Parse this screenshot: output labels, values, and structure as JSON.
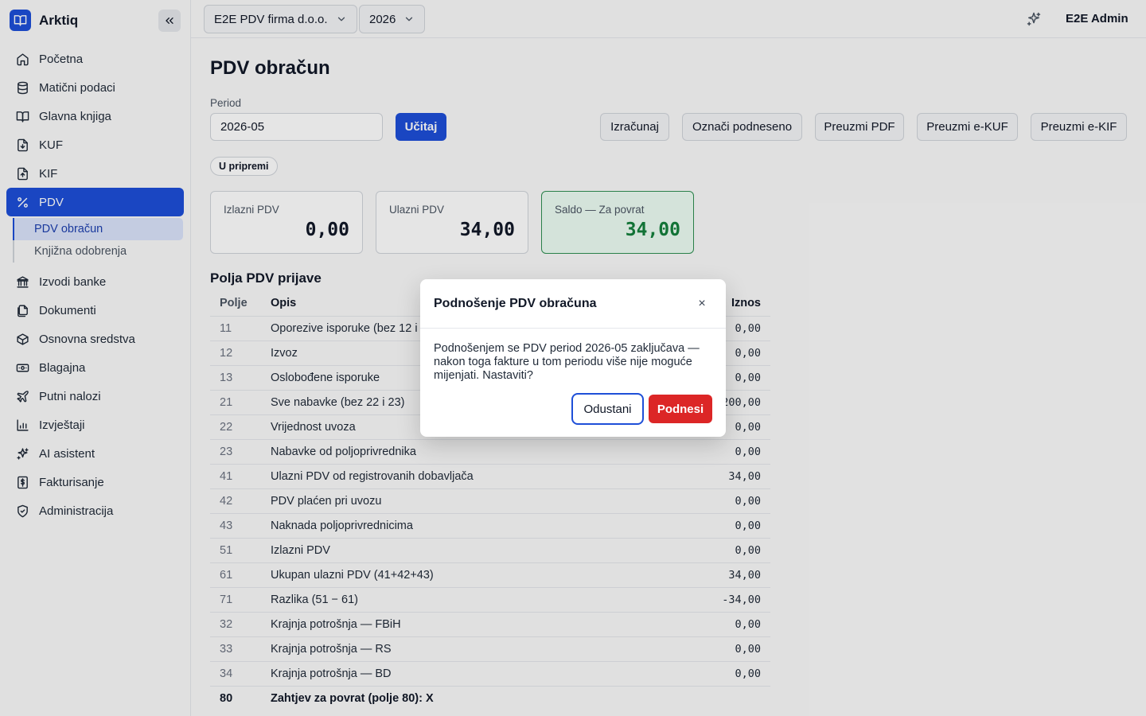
{
  "app": {
    "name": "Arktiq"
  },
  "sidebar": {
    "items": [
      {
        "label": "Početna",
        "icon": "home-icon"
      },
      {
        "label": "Matični podaci",
        "icon": "database-icon"
      },
      {
        "label": "Glavna knjiga",
        "icon": "book-open-icon"
      },
      {
        "label": "KUF",
        "icon": "file-download-icon"
      },
      {
        "label": "KIF",
        "icon": "file-upload-icon"
      },
      {
        "label": "PDV",
        "icon": "percent-icon",
        "active": true
      },
      {
        "label": "Izvodi banke",
        "icon": "bank-icon"
      },
      {
        "label": "Dokumenti",
        "icon": "documents-icon"
      },
      {
        "label": "Osnovna sredstva",
        "icon": "box-icon"
      },
      {
        "label": "Blagajna",
        "icon": "banknote-icon"
      },
      {
        "label": "Putni nalozi",
        "icon": "plane-icon"
      },
      {
        "label": "Izvještaji",
        "icon": "bar-chart-icon"
      },
      {
        "label": "AI asistent",
        "icon": "sparkles-icon"
      },
      {
        "label": "Fakturisanje",
        "icon": "invoice-dollar-icon"
      },
      {
        "label": "Administracija",
        "icon": "shield-icon"
      }
    ],
    "pdv_sub": [
      {
        "label": "PDV obračun",
        "active": true
      },
      {
        "label": "Knjižna odobrenja"
      }
    ]
  },
  "topbar": {
    "company": "E2E PDV firma d.o.o.",
    "year": "2026",
    "user": "E2E Admin"
  },
  "page": {
    "title": "PDV obračun",
    "period_label": "Period",
    "period_value": "2026-05",
    "load_button": "Učitaj",
    "actions": [
      "Izračunaj",
      "Označi podneseno",
      "Preuzmi PDF",
      "Preuzmi e-KUF",
      "Preuzmi e-KIF"
    ],
    "status": "U pripremi"
  },
  "cards": [
    {
      "label": "Izlazni PDV",
      "value": "0,00"
    },
    {
      "label": "Ulazni PDV",
      "value": "34,00"
    },
    {
      "label": "Saldo — Za povrat",
      "value": "34,00"
    }
  ],
  "fields": {
    "title": "Polja PDV prijave",
    "headers": {
      "polje": "Polje",
      "opis": "Opis",
      "iznos": "Iznos"
    },
    "rows": [
      {
        "polje": "11",
        "opis": "Oporezive isporuke (bez 12 i 13)",
        "iznos": "0,00"
      },
      {
        "polje": "12",
        "opis": "Izvoz",
        "iznos": "0,00"
      },
      {
        "polje": "13",
        "opis": "Oslobođene isporuke",
        "iznos": "0,00"
      },
      {
        "polje": "21",
        "opis": "Sve nabavke (bez 22 i 23)",
        "iznos": "200,00"
      },
      {
        "polje": "22",
        "opis": "Vrijednost uvoza",
        "iznos": "0,00"
      },
      {
        "polje": "23",
        "opis": "Nabavke od poljoprivrednika",
        "iznos": "0,00"
      },
      {
        "polje": "41",
        "opis": "Ulazni PDV od registrovanih dobavljača",
        "iznos": "34,00"
      },
      {
        "polje": "42",
        "opis": "PDV plaćen pri uvozu",
        "iznos": "0,00"
      },
      {
        "polje": "43",
        "opis": "Naknada poljoprivrednicima",
        "iznos": "0,00"
      },
      {
        "polje": "51",
        "opis": "Izlazni PDV",
        "iznos": "0,00"
      },
      {
        "polje": "61",
        "opis": "Ukupan ulazni PDV (41+42+43)",
        "iznos": "34,00"
      },
      {
        "polje": "71",
        "opis": "Razlika (51 − 61)",
        "iznos": "-34,00"
      },
      {
        "polje": "32",
        "opis": "Krajnja potrošnja — FBiH",
        "iznos": "0,00"
      },
      {
        "polje": "33",
        "opis": "Krajnja potrošnja — RS",
        "iznos": "0,00"
      },
      {
        "polje": "34",
        "opis": "Krajnja potrošnja — BD",
        "iznos": "0,00"
      },
      {
        "polje": "80",
        "opis": "Zahtjev za povrat (polje 80): X",
        "iznos": "",
        "bold": true
      }
    ]
  },
  "modal": {
    "title": "Podnošenje PDV obračuna",
    "close": "×",
    "body": "Podnošenjem se PDV period 2026-05 zaključava — nakon toga fakture u tom periodu više nije moguće mijenjati. Nastaviti?",
    "cancel": "Odustani",
    "submit": "Podnesi"
  },
  "colors": {
    "primary": "#1e4fd8",
    "danger": "#dc2626",
    "success": "#15803d"
  }
}
